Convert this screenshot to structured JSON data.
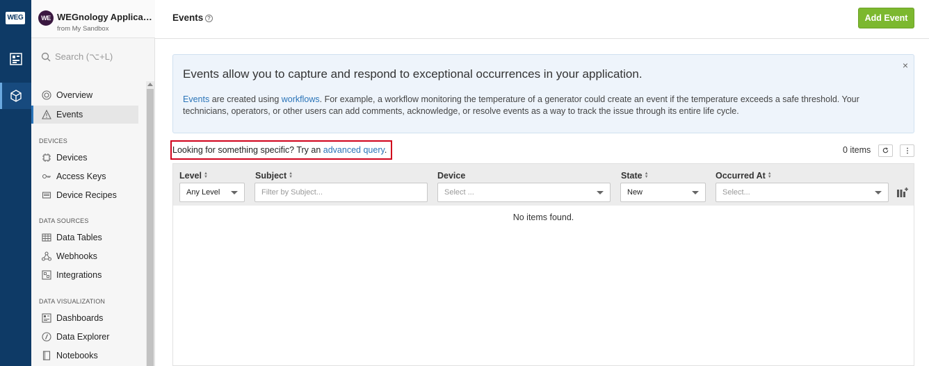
{
  "rail": {
    "logo": "WEG",
    "items": [
      "dashboard-icon",
      "cube-icon"
    ]
  },
  "sidebar": {
    "app_avatar": "WE",
    "app_name": "WEGnology Applicati...",
    "app_sub": "from My Sandbox",
    "search_placeholder": "Search (⌥+L)",
    "items": [
      {
        "label": "Overview",
        "icon": "overview-icon"
      },
      {
        "label": "Events",
        "icon": "warning-icon"
      }
    ],
    "devices_label": "DEVICES",
    "devices_items": [
      {
        "label": "Devices",
        "icon": "chip-icon"
      },
      {
        "label": "Access Keys",
        "icon": "key-icon"
      },
      {
        "label": "Device Recipes",
        "icon": "recipe-icon"
      }
    ],
    "data_sources_label": "DATA SOURCES",
    "data_sources_items": [
      {
        "label": "Data Tables",
        "icon": "table-icon"
      },
      {
        "label": "Webhooks",
        "icon": "webhook-icon"
      },
      {
        "label": "Integrations",
        "icon": "integrations-icon"
      }
    ],
    "data_viz_label": "DATA VISUALIZATION",
    "data_viz_items": [
      {
        "label": "Dashboards",
        "icon": "dashboard-icon"
      },
      {
        "label": "Data Explorer",
        "icon": "explorer-icon"
      },
      {
        "label": "Notebooks",
        "icon": "notebook-icon"
      }
    ]
  },
  "header": {
    "title": "Events",
    "add_button": "Add Event"
  },
  "info": {
    "title": "Events allow you to capture and respond to exceptional occurrences in your application.",
    "link1": "Events",
    "text1": " are created using ",
    "link2": "workflows",
    "text2": ". For example, a workflow monitoring the temperature of a generator could create an event if the temperature exceeds a safe threshold. Your technicians, operators, or other users can add comments, acknowledge, or resolve events as a way to track the issue through its entire life cycle.",
    "close": "×"
  },
  "query": {
    "text": "Looking for something specific? Try an ",
    "link": "advanced query",
    "suffix": "."
  },
  "items_count": "0 items",
  "table": {
    "columns": [
      {
        "label": "Level",
        "sortable": true,
        "filter": "Any Level",
        "filter_type": "select",
        "has_value": true
      },
      {
        "label": "Subject",
        "sortable": true,
        "filter": "Filter by Subject...",
        "filter_type": "input",
        "has_value": false
      },
      {
        "label": "Device",
        "sortable": false,
        "filter": "Select ...",
        "filter_type": "select",
        "has_value": false
      },
      {
        "label": "State",
        "sortable": true,
        "filter": "New",
        "filter_type": "select",
        "has_value": true
      },
      {
        "label": "Occurred At",
        "sortable": true,
        "filter": "Select...",
        "filter_type": "select",
        "has_value": false
      }
    ],
    "empty_text": "No items found."
  }
}
